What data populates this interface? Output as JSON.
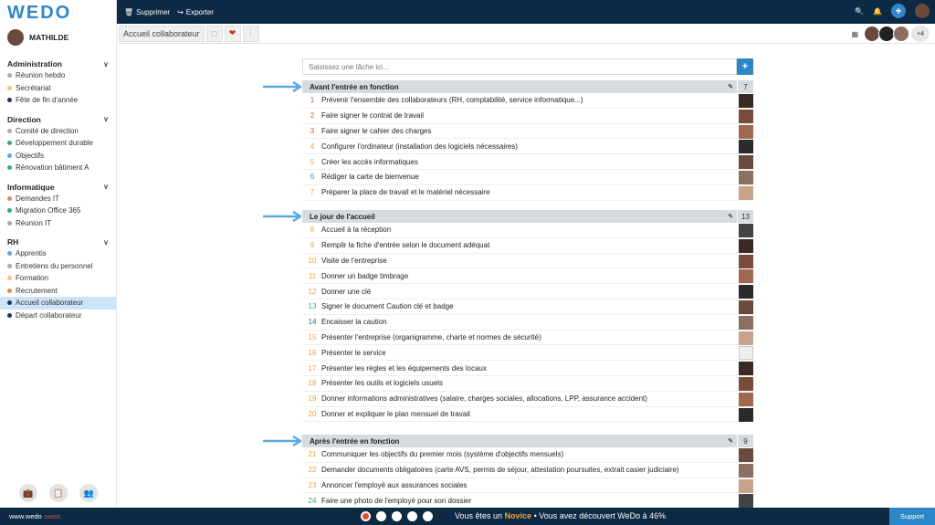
{
  "app": {
    "logo": "WEDO",
    "user": "MATHILDE"
  },
  "sidebar": {
    "groups": [
      {
        "title": "Administration",
        "items": [
          {
            "label": "Réunion hebdo",
            "color": "#aaaaaa"
          },
          {
            "label": "Secrétariat",
            "color": "#f5c37a"
          },
          {
            "label": "Fête de fin d'année",
            "color": "#1d3557"
          }
        ]
      },
      {
        "title": "Direction",
        "items": [
          {
            "label": "Comité de direction",
            "color": "#aaaaaa"
          },
          {
            "label": "Développement durable",
            "color": "#3aa76d"
          },
          {
            "label": "Objectifs",
            "color": "#5aa9e6"
          },
          {
            "label": "Rénovation bâtiment A",
            "color": "#3aa76d"
          }
        ]
      },
      {
        "title": "Informatique",
        "items": [
          {
            "label": "Demandes IT",
            "color": "#e58a4a"
          },
          {
            "label": "Migration Office 365",
            "color": "#3aa76d"
          },
          {
            "label": "Réunion IT",
            "color": "#aaaaaa"
          }
        ]
      },
      {
        "title": "RH",
        "items": [
          {
            "label": "Apprentis",
            "color": "#5aa9e6"
          },
          {
            "label": "Entretiens du personnel",
            "color": "#aaaaaa"
          },
          {
            "label": "Formation",
            "color": "#f5c37a"
          },
          {
            "label": "Recrutement",
            "color": "#e58a4a"
          },
          {
            "label": "Accueil collaborateur",
            "color": "#1d3557",
            "active": true
          },
          {
            "label": "Départ collaborateur",
            "color": "#1d3557"
          }
        ]
      }
    ]
  },
  "toolbar": {
    "delete_label": "Supprimer",
    "export_label": "Exporter"
  },
  "subbar": {
    "tab": "Accueil collaborateur",
    "more_members": "+4"
  },
  "task_input": {
    "placeholder": "Saisissez une tâche ici..."
  },
  "sections": [
    {
      "title": "Avant l'entrée en fonction",
      "count": "7",
      "tasks": [
        {
          "n": "1",
          "label": "Prévenir l'ensemble des collaborateurs (RH, comptabilité, service informatique...)",
          "color": "#d9534f"
        },
        {
          "n": "2",
          "label": "Faire signer le contrat de travail",
          "color": "#e4572e"
        },
        {
          "n": "3",
          "label": "Faire signer le cahier des charges",
          "color": "#e4572e"
        },
        {
          "n": "4",
          "label": "Configurer l'ordinateur (installation des logiciels nécessaires)",
          "color": "#f0a13a"
        },
        {
          "n": "5",
          "label": "Créer les accès informatiques",
          "color": "#f0a13a"
        },
        {
          "n": "6",
          "label": "Rédiger la carte de bienvenue",
          "color": "#3aa76d"
        },
        {
          "n": "7",
          "label": "Préparer la place de travail et le matériel nécessaire",
          "color": "#f0a13a"
        }
      ]
    },
    {
      "title": "Le jour de l'accueil",
      "count": "13",
      "tasks": [
        {
          "n": "8",
          "label": "Accueil à la réception",
          "color": "#f0a13a"
        },
        {
          "n": "9",
          "label": "Remplir la fiche d'entrée selon le document adéquat",
          "color": "#f0a13a"
        },
        {
          "n": "10",
          "label": "Visite de l'entreprise",
          "color": "#f0a13a"
        },
        {
          "n": "11",
          "label": "Donner un badge timbrage",
          "color": "#f0a13a"
        },
        {
          "n": "12",
          "label": "Donner une clé",
          "color": "#f0a13a"
        },
        {
          "n": "13",
          "label": "Signer le document Caution clé et badge",
          "color": "#3aa76d"
        },
        {
          "n": "14",
          "label": "Encaisser la caution",
          "color": "#2a7a4b"
        },
        {
          "n": "15",
          "label": "Présenter l'entreprise (organigramme, charte et normes de sécurité)",
          "color": "#f0a13a"
        },
        {
          "n": "16",
          "label": "Présenter le service",
          "color": "#f0a13a"
        },
        {
          "n": "17",
          "label": "Présenter les règles et les équipements des locaux",
          "color": "#f0a13a"
        },
        {
          "n": "18",
          "label": "Présenter les outils et logiciels usuels",
          "color": "#f0a13a"
        },
        {
          "n": "19",
          "label": "Donner informations administratives (salaire, charges sociales, allocations, LPP, assurance accident)",
          "color": "#f0a13a"
        },
        {
          "n": "20",
          "label": "Donner et expliquer le plan mensuel de travail",
          "color": "#f0a13a"
        }
      ]
    },
    {
      "title": "Après l'entrée en fonction",
      "count": "9",
      "tasks": [
        {
          "n": "21",
          "label": "Communiquer les objectifs du premier mois (système d'objectifs mensuels)",
          "color": "#f0a13a"
        },
        {
          "n": "22",
          "label": "Demander documents obligatoires (carte AVS, permis de séjour, attestation poursuites, extrait casier judiciaire)",
          "color": "#f0a13a"
        },
        {
          "n": "23",
          "label": "Annoncer l'employé aux assurances sociales",
          "color": "#f0a13a"
        },
        {
          "n": "24",
          "label": "Faire une photo de l'employé pour son dossier",
          "color": "#3aa76d"
        }
      ]
    }
  ],
  "statusbar": {
    "site": "www.wedo",
    "site_suffix": "swiss",
    "msg_pre": "Vous êtes un",
    "msg_level": "Novice",
    "msg_post": "• Vous avez découvert WeDo à 46%",
    "support": "Support"
  }
}
